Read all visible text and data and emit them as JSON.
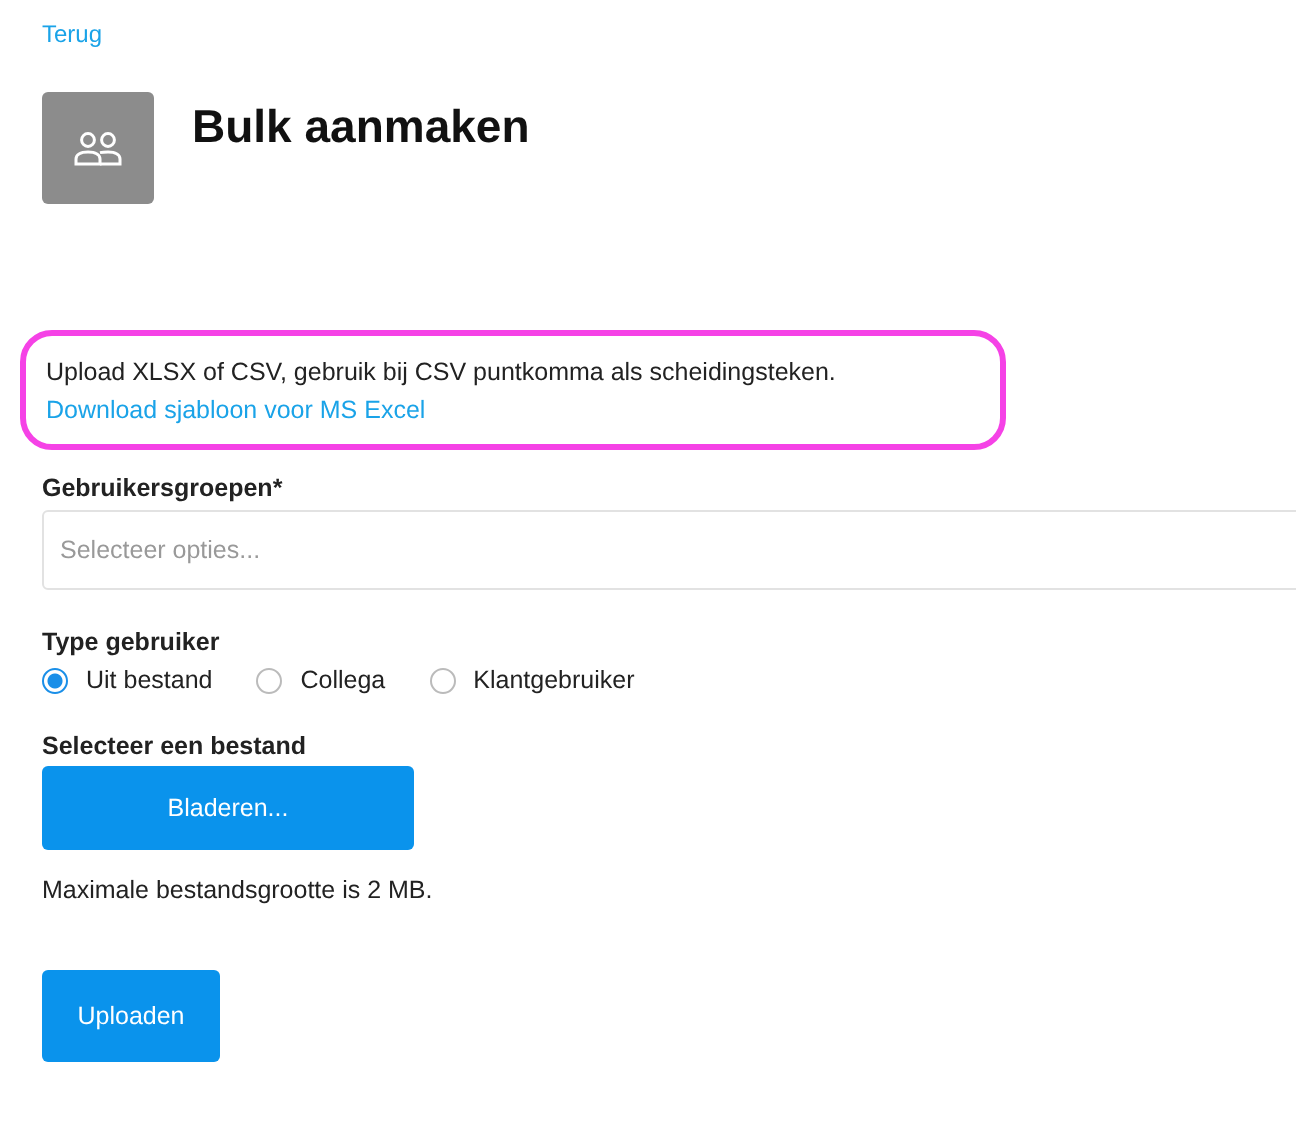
{
  "back_link": "Terug",
  "title": "Bulk aanmaken",
  "notice": {
    "text": "Upload XLSX of CSV, gebruik bij CSV puntkomma als scheidingsteken.",
    "link": "Download sjabloon voor MS Excel",
    "highlighted": true
  },
  "groups_field": {
    "label": "Gebruikersgroepen*",
    "placeholder": "Selecteer opties..."
  },
  "user_type": {
    "label": "Type gebruiker",
    "options": [
      {
        "label": "Uit bestand",
        "selected": true
      },
      {
        "label": "Collega",
        "selected": false
      },
      {
        "label": "Klantgebruiker",
        "selected": false
      }
    ]
  },
  "file": {
    "label": "Selecteer een bestand",
    "button": "Bladeren...",
    "hint": "Maximale bestandsgrootte is 2 MB."
  },
  "submit": "Uploaden"
}
